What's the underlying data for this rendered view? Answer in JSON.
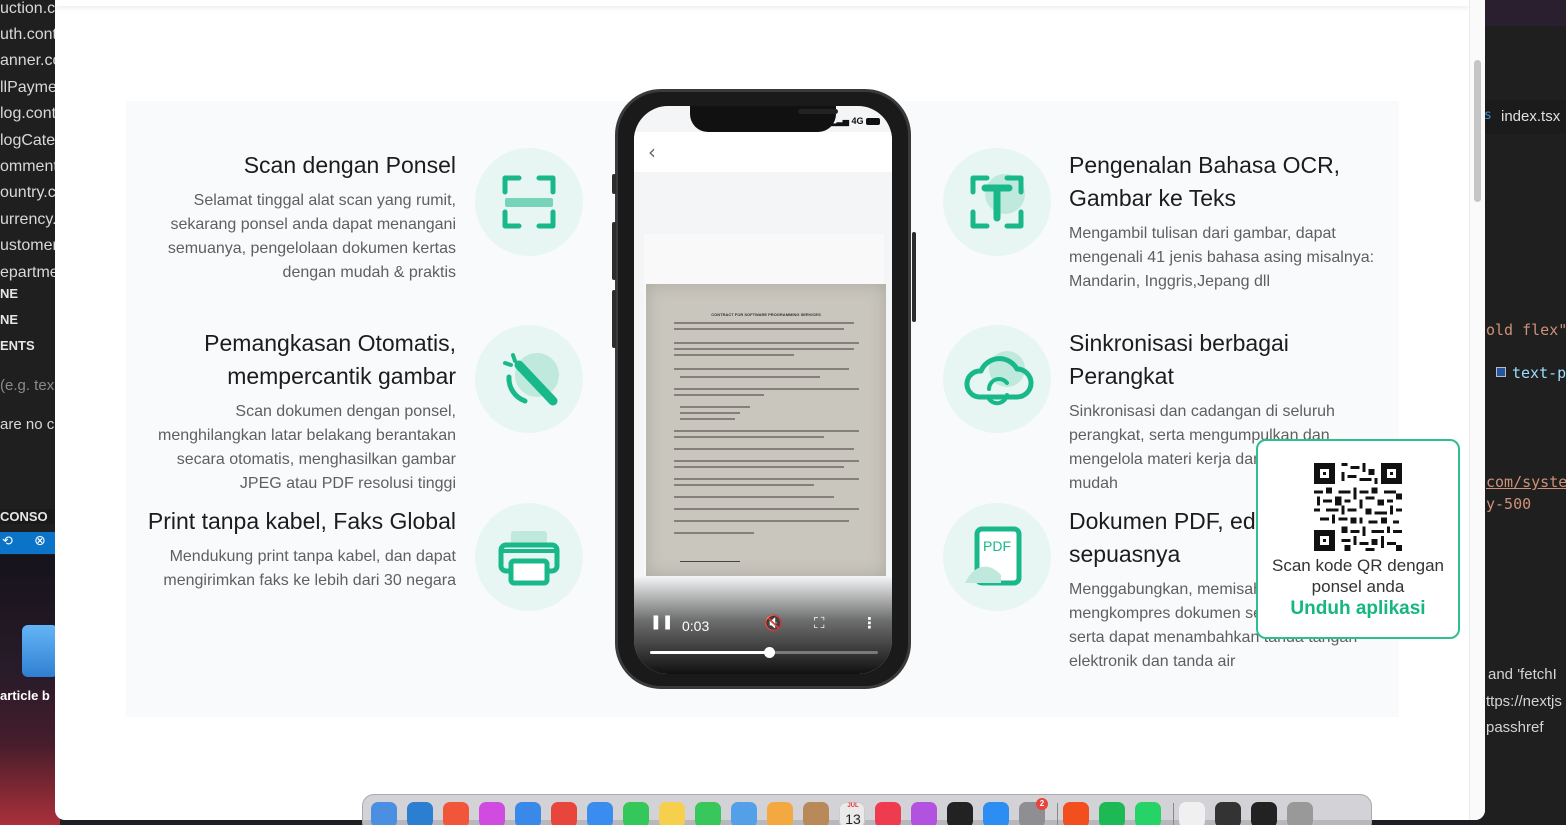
{
  "background_editor_left": {
    "files": [
      "uction.c",
      "uth.cont",
      "anner.co",
      "llPayme",
      "log.cont",
      "logCate",
      "omment",
      "ountry.c",
      "urrency.",
      "ustomer",
      "epartme"
    ],
    "captions": [
      "NE",
      "NE",
      "ENTS"
    ],
    "placeholder": "(e.g. tex",
    "empty_text": "are no c",
    "console_label": "CONSO",
    "desktop_label": "article b"
  },
  "background_editor_right": {
    "tab_label": "index.tsx",
    "code_lines": [
      "old flex\"",
      "text-p",
      "com/syste",
      "y-500",
      "and 'fetchI",
      "ttps://nextjs",
      "passhref"
    ]
  },
  "features_left": [
    {
      "title": "Scan dengan Ponsel",
      "description": "Selamat tinggal alat scan yang rumit, sekarang ponsel anda dapat menangani semuanya, pengelolaan dokumen kertas dengan mudah & praktis",
      "icon": "scan-frame-icon"
    },
    {
      "title": "Pemangkasan Otomatis, mempercantik gambar",
      "description": "Scan dokumen dengan ponsel, menghilangkan latar belakang berantakan secara otomatis, menghasilkan gambar JPEG atau PDF resolusi tinggi",
      "icon": "magic-wand-icon"
    },
    {
      "title": "Print tanpa kabel, Faks Global",
      "description": "Mendukung print tanpa kabel, dan dapat mengirimkan faks ke lebih dari 30 negara",
      "icon": "printer-icon"
    }
  ],
  "features_right": [
    {
      "title": "Pengenalan Bahasa OCR, Gambar ke Teks",
      "description": "Mengambil tulisan dari gambar, dapat mengenali 41 jenis bahasa asing misalnya: Mandarin, Inggris,Jepang dll",
      "icon": "text-recognition-icon"
    },
    {
      "title": "Sinkronisasi berbagai Perangkat",
      "description": "Sinkronisasi dan cadangan di seluruh perangkat, serta mengumpulkan dan mengelola materi kerja dan belajar dengan mudah",
      "icon": "cloud-sync-icon"
    },
    {
      "title": "Dokumen PDF, edit sepuasnya",
      "description": "Menggabungkan, memisahkan, mengkompres dokumen secara mudah, serta dapat menambahkan tanda tangan elektronik dan tanda air",
      "icon": "pdf-document-icon"
    }
  ],
  "phone": {
    "status": "4G",
    "back_glyph": "‹",
    "document_title": "CONTRACT FOR SOFTWARE PROGRAMMING SERVICES",
    "video": {
      "time": "0:03",
      "progress": 0.52,
      "playing": true,
      "muted": true
    }
  },
  "qr_popup": {
    "caption": "Scan kode QR dengan ponsel anda",
    "link_label": "Unduh aplikasi"
  },
  "dock": {
    "calendar_day": "13",
    "calendar_month": "JUL",
    "settings_badge": "2",
    "app_colors": [
      "#4a8fe0",
      "#2c7fd0",
      "#f2563a",
      "#d04be0",
      "#3a88e8",
      "#e8453c",
      "#3a8cf0",
      "#34c759",
      "#f6d04d",
      "#37c75a",
      "#54a0e8",
      "#f3a940",
      "#b88a5a",
      "#eaeaea",
      "#ef3b4f",
      "#b253e0",
      "#222222",
      "#2c8df2",
      "#8e8e93",
      "#f24e1e",
      "#1db954",
      "#25d366",
      "#f0f0f0",
      "#333333",
      "#222222",
      "#999999"
    ]
  }
}
